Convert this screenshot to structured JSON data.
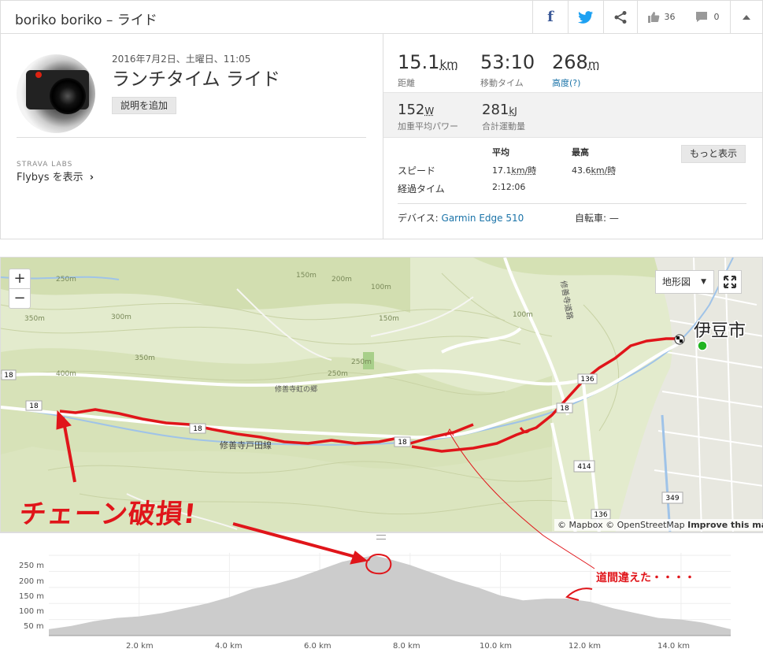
{
  "header": {
    "title": "boriko boriko – ライド",
    "kudos_count": "36",
    "comment_count": "0"
  },
  "activity": {
    "date": "2016年7月2日、土曜日、11:05",
    "name": "ランチタイム ライド",
    "add_description": "説明を追加",
    "labs_label": "STRAVA LABS",
    "flyby_label": "Flybys を表示"
  },
  "stats": {
    "distance": {
      "value": "15.1",
      "unit": "km",
      "label": "距離"
    },
    "moving_time": {
      "value": "53:10",
      "label": "移動タイム"
    },
    "elevation": {
      "value": "268",
      "unit": "m",
      "label": "高度(?)"
    },
    "power": {
      "value": "152",
      "unit": "W",
      "label": "加重平均パワー"
    },
    "work": {
      "value": "281",
      "unit": "kJ",
      "label": "合計運動量"
    },
    "table_header_avg": "平均",
    "table_header_max": "最高",
    "speed_label": "スピード",
    "speed_avg": "17.1",
    "speed_max": "43.6",
    "speed_unit": "km/時",
    "elapsed_label": "経過タイム",
    "elapsed_value": "2:12:06",
    "more_button": "もっと表示",
    "device_label": "デバイス:",
    "device_value": "Garmin Edge 510",
    "bike_label": "自転車:",
    "bike_value": "—"
  },
  "map": {
    "zoom_in": "+",
    "zoom_out": "−",
    "terrain_label": "地形図",
    "city_label": "伊豆市",
    "road_label": "修善寺戸田線",
    "road_label_2": "修善寺道路",
    "place_label": "修善寺虹の郷",
    "route_labels": [
      "18",
      "18",
      "18",
      "18",
      "18",
      "136",
      "414",
      "136",
      "349"
    ],
    "contour_labels": [
      "250m",
      "150m",
      "300m",
      "350m",
      "400m",
      "350m",
      "200m",
      "250m",
      "100m",
      "100m",
      "250m",
      "150m"
    ],
    "attribution": {
      "mapbox": "© Mapbox",
      "osm": "© OpenStreetMap",
      "improve": "Improve this map"
    }
  },
  "elevation_chart": {
    "y_labels": [
      "250 m",
      "200 m",
      "150 m",
      "100 m",
      "50 m"
    ],
    "x_labels": [
      "2.0 km",
      "4.0 km",
      "6.0 km",
      "8.0 km",
      "10.0 km",
      "12.0 km",
      "14.0 km"
    ]
  },
  "chart_data": {
    "type": "area",
    "x": [
      0,
      0.5,
      1.0,
      1.5,
      2.0,
      2.5,
      3.0,
      3.5,
      4.0,
      4.5,
      5.0,
      5.5,
      6.0,
      6.5,
      7.0,
      7.2,
      7.5,
      8.0,
      8.5,
      9.0,
      9.5,
      10.0,
      10.5,
      11.0,
      11.5,
      12.0,
      12.5,
      13.0,
      13.5,
      14.0,
      14.5,
      15.1
    ],
    "y": [
      20,
      30,
      45,
      55,
      60,
      70,
      85,
      100,
      120,
      145,
      160,
      180,
      205,
      230,
      245,
      250,
      240,
      220,
      195,
      170,
      150,
      125,
      110,
      115,
      115,
      105,
      85,
      70,
      55,
      50,
      40,
      20
    ],
    "xlabel": "",
    "ylabel": "",
    "ylim": [
      0,
      270
    ],
    "xlim": [
      0,
      15.1
    ],
    "grid": true
  },
  "annotations": {
    "chain_broken": "チェーン破損!",
    "wrong_way": "道間違えた・・・・"
  },
  "colors": {
    "route": "#e0151a",
    "annotation": "#e0151a",
    "link": "#1a73a8",
    "map_bg": "#dfe8c6",
    "elevation_fill": "#cccccc"
  }
}
